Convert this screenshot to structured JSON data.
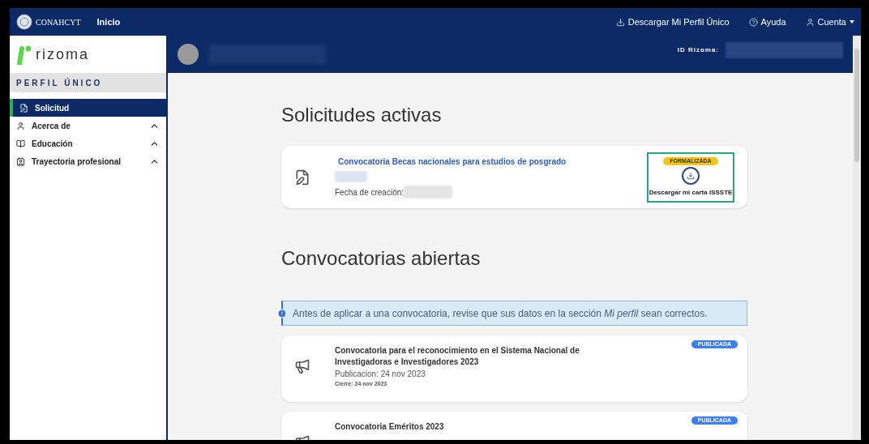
{
  "topbar": {
    "brand": "CONAHCYT",
    "home": "Inicio",
    "links": [
      {
        "kind": "download",
        "label": "Descargar Mi Perfil Único"
      },
      {
        "kind": "help",
        "label": "Ayuda"
      },
      {
        "kind": "account",
        "label": "Cuenta"
      }
    ]
  },
  "sidebar": {
    "logo": "rizoma",
    "section": "PERFIL ÚNICO",
    "items": [
      {
        "kind": "file",
        "label": "Solicitud",
        "selected": true
      },
      {
        "kind": "user",
        "label": "Acerca de",
        "selected": false,
        "expanded": true
      },
      {
        "kind": "book",
        "label": "Educación",
        "selected": false,
        "expanded": true
      },
      {
        "kind": "badge",
        "label": "Trayectoria profesional",
        "selected": false,
        "expanded": true
      }
    ]
  },
  "profile_bar": {
    "id_label": "ID Rizoma:"
  },
  "active": {
    "title": "Solicitudes activas",
    "cards": [
      {
        "title": "Convocatoria Becas nacionales para estudios de posgrado",
        "date_label": "Fecha de creación:",
        "status": "FORMALIZADA",
        "action": "Descargar mi carta ISSSTE"
      }
    ]
  },
  "open": {
    "title": "Convocatorias abiertas",
    "notice": "Antes de aplicar a una convocatoria, revise que sus datos en la sección *Mi perfil* sean correctos.",
    "cards": [
      {
        "title": "Convocatoria para el reconocimiento en el Sistema Nacional de Investigadoras e Investigadores 2023",
        "published": "Publicacion: 24 nov 2023",
        "closing": "Cierre: 24 nov 2023",
        "status": "PUBLICADA"
      },
      {
        "title": "Convocatoria Eméritos 2023",
        "status": "PUBLICADA"
      }
    ]
  }
}
